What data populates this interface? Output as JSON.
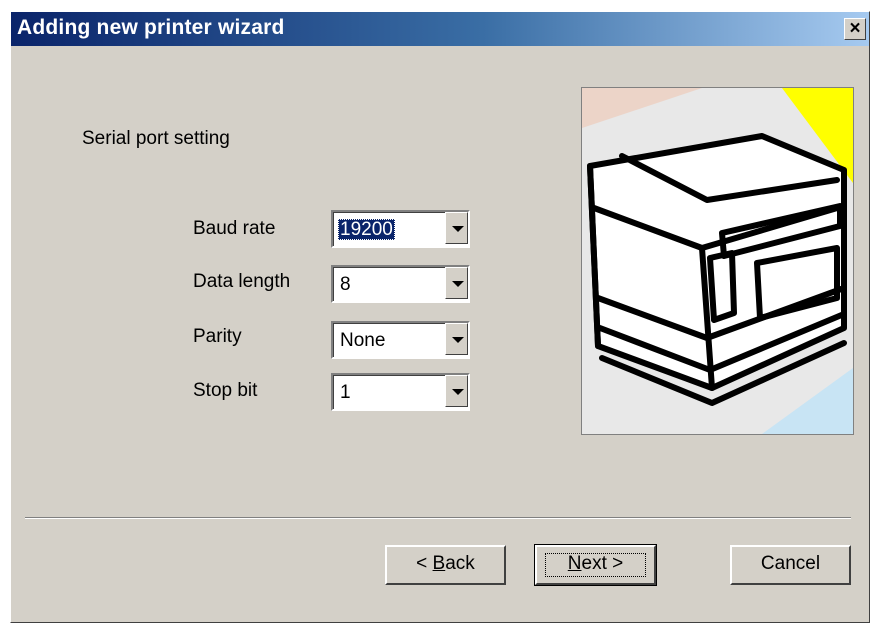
{
  "window": {
    "title": "Adding new printer wizard",
    "close_glyph": "✕"
  },
  "section_label": "Serial port setting",
  "fields": [
    {
      "label": "Baud rate",
      "value": "19200"
    },
    {
      "label": "Data length",
      "value": "8"
    },
    {
      "label": "Parity",
      "value": "None"
    },
    {
      "label": "Stop bit",
      "value": "1"
    }
  ],
  "illustration": {
    "icon": "printer-illustration"
  },
  "buttons": {
    "back": {
      "prefix": "< ",
      "accel": "B",
      "rest": "ack"
    },
    "next": {
      "accel": "N",
      "rest": "ext >"
    },
    "cancel": "Cancel"
  },
  "colors": {
    "titlebar_start": "#0a246a",
    "titlebar_end": "#a6caf0",
    "face": "#d4d0c8",
    "selection": "#0a246a"
  }
}
